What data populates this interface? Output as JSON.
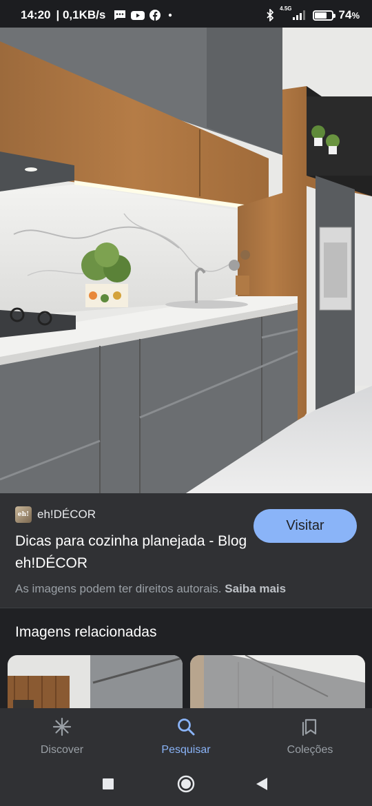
{
  "status_bar": {
    "time": "14:20",
    "speed": "| 0,1KB/s",
    "network_type": "4.5G",
    "battery_percent": "74",
    "battery_unit": "%",
    "battery_level": 0.74,
    "icons": [
      "message-icon",
      "youtube-icon",
      "facebook-icon",
      "dot-icon",
      "bluetooth-icon",
      "signal-icon",
      "battery-icon"
    ]
  },
  "result": {
    "site_name": "eh!DÉCOR",
    "site_logo_text": "eh!",
    "title": "Dicas para cozinha planejada - Blog eh!DÉCOR",
    "visit_label": "Visitar",
    "copyright_text": "As imagens podem ter direitos autorais.",
    "learn_more_label": "Saiba mais"
  },
  "related": {
    "title": "Imagens relacionadas"
  },
  "bottom_nav": {
    "items": [
      {
        "label": "Discover",
        "icon": "asterisk-icon",
        "active": false
      },
      {
        "label": "Pesquisar",
        "icon": "search-icon",
        "active": true
      },
      {
        "label": "Coleções",
        "icon": "collections-icon",
        "active": false
      }
    ]
  },
  "colors": {
    "accent": "#8ab4f8",
    "panel": "#303134",
    "background": "#202124"
  }
}
